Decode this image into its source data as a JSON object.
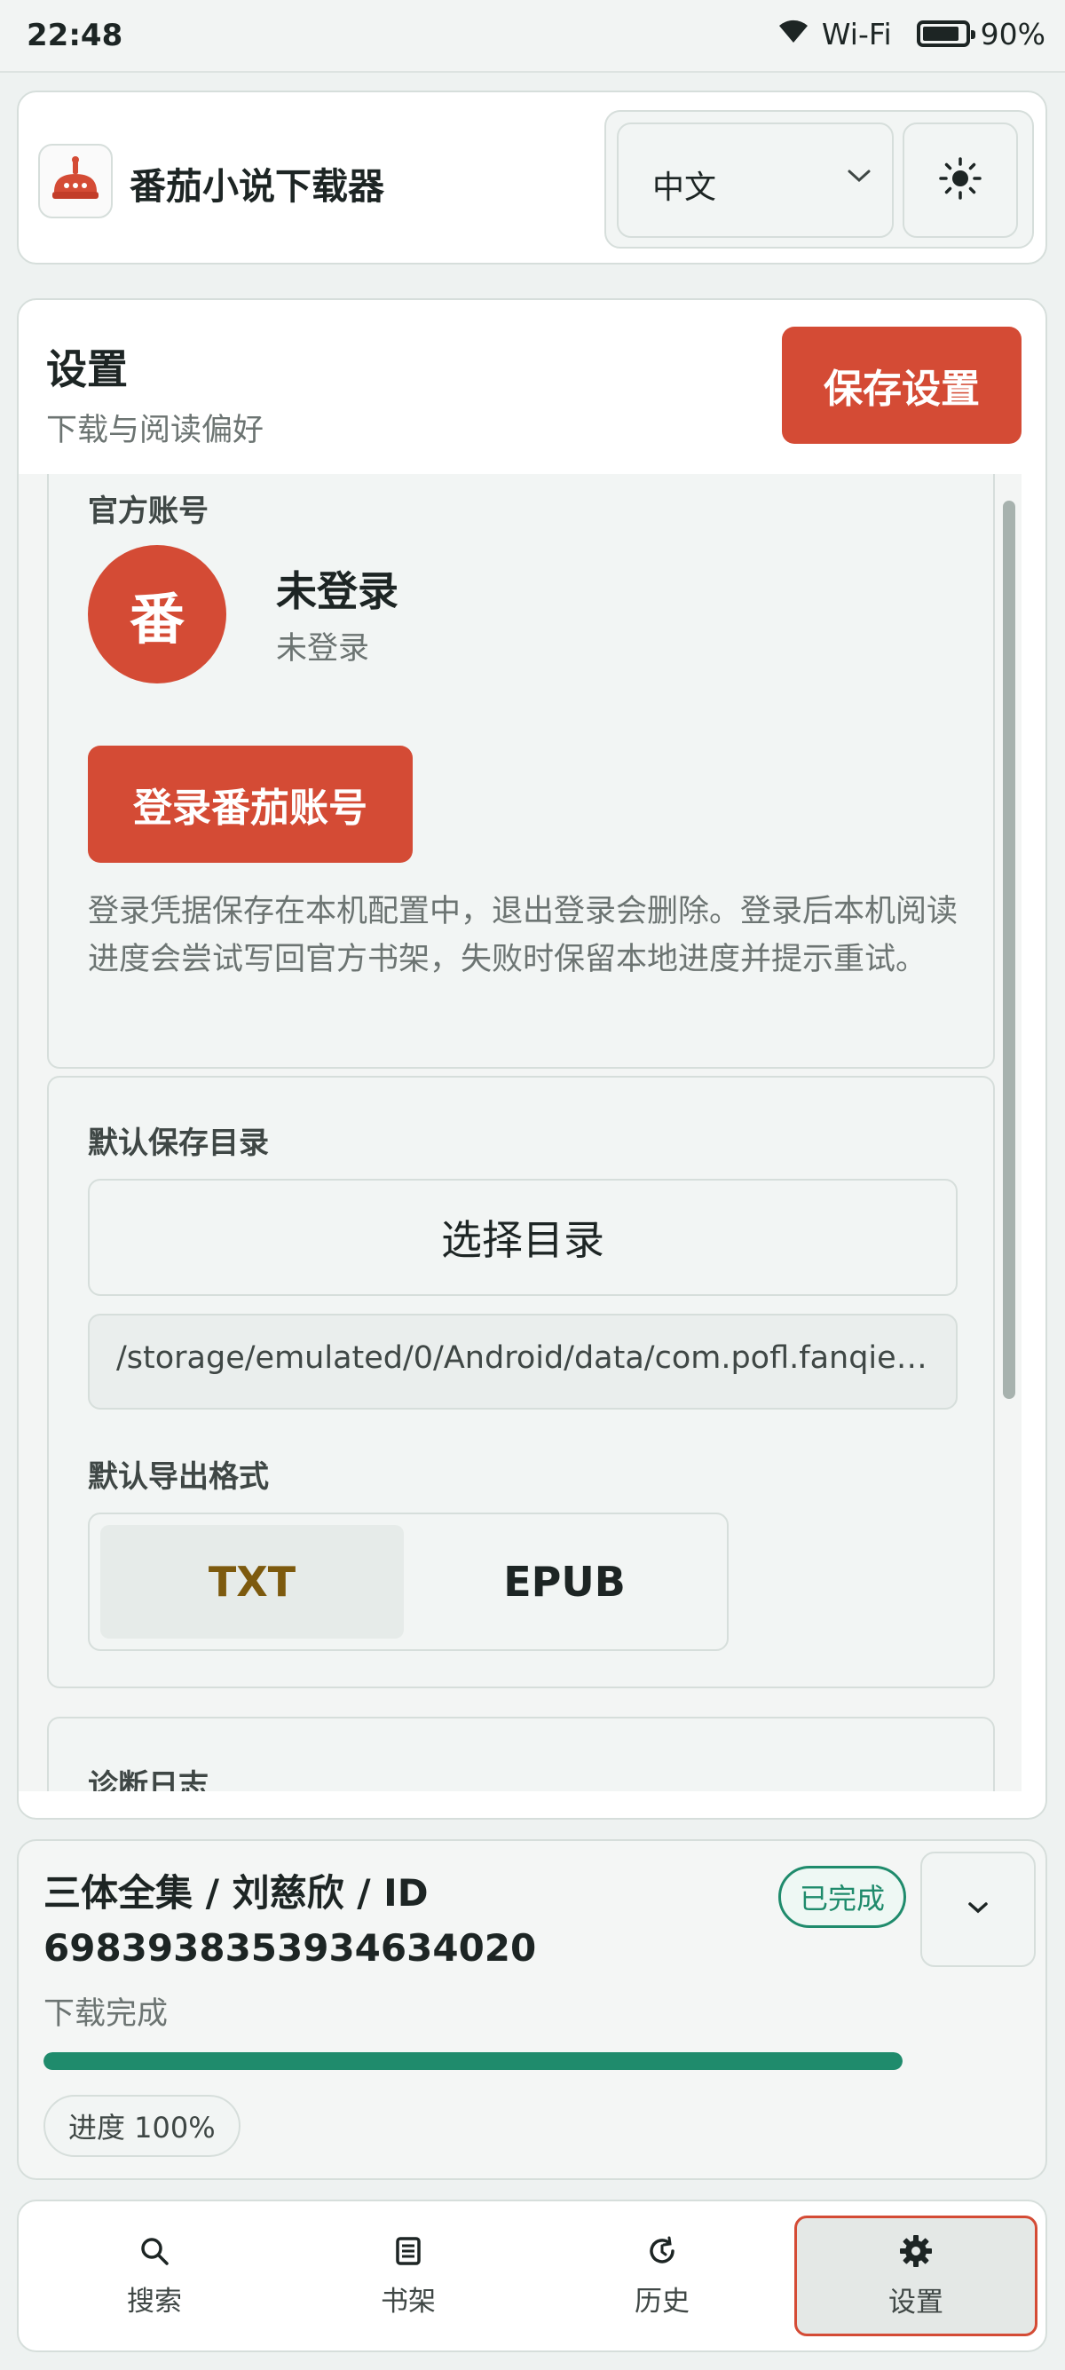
{
  "status_bar": {
    "time": "22:48",
    "network": "Wi-Fi",
    "battery": "90%",
    "battery_level": 0.9
  },
  "header": {
    "app_title": "番茄小说下载器",
    "language": "中文",
    "theme_icon": "sun-icon",
    "logo_icon": "tomato-logo-icon"
  },
  "settings": {
    "title": "设置",
    "subtitle": "下载与阅读偏好",
    "save_button": "保存设置",
    "account": {
      "section_label": "官方账号",
      "avatar_char": "番",
      "name": "未登录",
      "status": "未登录",
      "login_button": "登录番茄账号",
      "description": "登录凭据保存在本机配置中，退出登录会删除。登录后本机阅读进度会尝试写回官方书架，失败时保留本地进度并提示重试。"
    },
    "directory": {
      "section_label": "默认保存目录",
      "choose_button": "选择目录",
      "path": "/storage/emulated/0/Android/data/com.pofl.fanqien…",
      "format_label": "默认导出格式",
      "formats": [
        "TXT",
        "EPUB"
      ],
      "selected_format": "TXT"
    },
    "log": {
      "section_label": "诊断日志"
    }
  },
  "download": {
    "title": "三体全集 / 刘慈欣 / ID 6983938353934634020",
    "badge": "已完成",
    "status": "下载完成",
    "progress": 1.0,
    "progress_label": "进度 100%",
    "accent": "#1f8b6c"
  },
  "nav": {
    "items": [
      {
        "label": "搜索",
        "icon": "search-icon"
      },
      {
        "label": "书架",
        "icon": "bookshelf-icon"
      },
      {
        "label": "历史",
        "icon": "history-icon"
      },
      {
        "label": "设置",
        "icon": "gear-icon"
      }
    ],
    "active": 3
  },
  "colors": {
    "brand": "#d44b35",
    "success": "#1f8b6c",
    "background": "#eef2f1"
  }
}
